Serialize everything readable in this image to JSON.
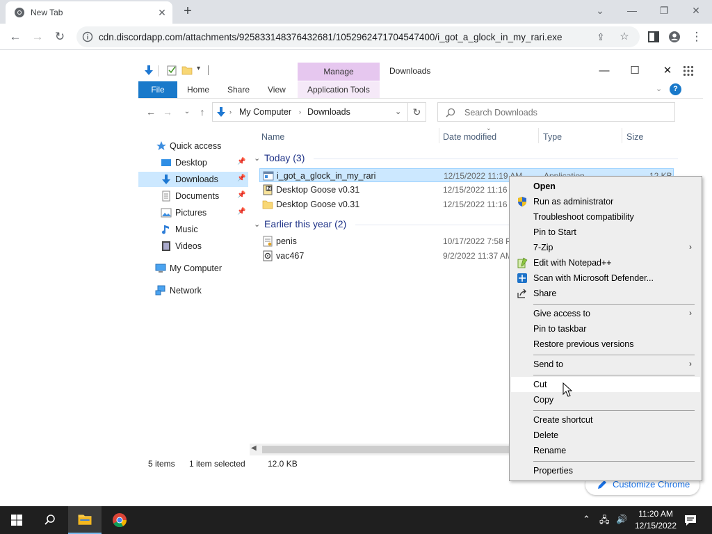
{
  "browser": {
    "tab_title": "New Tab",
    "url": "cdn.discordapp.com/attachments/925833148376432681/1052962471704547400/i_got_a_glock_in_my_rari.exe",
    "customize_label": "Customize Chrome"
  },
  "explorer": {
    "manage_label": "Manage",
    "window_title": "Downloads",
    "ribbon_tabs": {
      "file": "File",
      "home": "Home",
      "share": "Share",
      "view": "View",
      "app_tools": "Application Tools"
    },
    "breadcrumb": [
      "My Computer",
      "Downloads"
    ],
    "search_placeholder": "Search Downloads",
    "nav": {
      "quick_access": "Quick access",
      "desktop": "Desktop",
      "downloads": "Downloads",
      "documents": "Documents",
      "pictures": "Pictures",
      "music": "Music",
      "videos": "Videos",
      "my_computer": "My Computer",
      "network": "Network"
    },
    "columns": {
      "name": "Name",
      "date": "Date modified",
      "type": "Type",
      "size": "Size"
    },
    "groups": {
      "today": "Today (3)",
      "earlier": "Earlier this year (2)"
    },
    "files": [
      {
        "name": "i_got_a_glock_in_my_rari",
        "date": "12/15/2022 11:19 AM",
        "type": "Application",
        "size": "12 KB"
      },
      {
        "name": "Desktop Goose v0.31",
        "date": "12/15/2022 11:16 AM",
        "type": "",
        "size": ""
      },
      {
        "name": "Desktop Goose v0.31",
        "date": "12/15/2022 11:16 AM",
        "type": "",
        "size": ""
      },
      {
        "name": "penis",
        "date": "10/17/2022 7:58 PM",
        "type": "",
        "size": ""
      },
      {
        "name": "vac467",
        "date": "9/2/2022 11:37 AM",
        "type": "",
        "size": ""
      }
    ],
    "status": {
      "items": "5 items",
      "selected": "1 item selected",
      "size": "12.0 KB"
    }
  },
  "context_menu": {
    "open": "Open",
    "run_admin": "Run as administrator",
    "troubleshoot": "Troubleshoot compatibility",
    "pin_start": "Pin to Start",
    "seven_zip": "7-Zip",
    "notepad": "Edit with Notepad++",
    "defender": "Scan with Microsoft Defender...",
    "share": "Share",
    "give_access": "Give access to",
    "pin_taskbar": "Pin to taskbar",
    "restore": "Restore previous versions",
    "send_to": "Send to",
    "cut": "Cut",
    "copy": "Copy",
    "create_shortcut": "Create shortcut",
    "delete": "Delete",
    "rename": "Rename",
    "properties": "Properties"
  },
  "taskbar": {
    "time": "11:20 AM",
    "date": "12/15/2022"
  },
  "colors": {
    "accent": "#1979ca",
    "selection": "#cce8ff",
    "manage": "#e6c7ef",
    "taskbar": "#1f1f1f"
  }
}
